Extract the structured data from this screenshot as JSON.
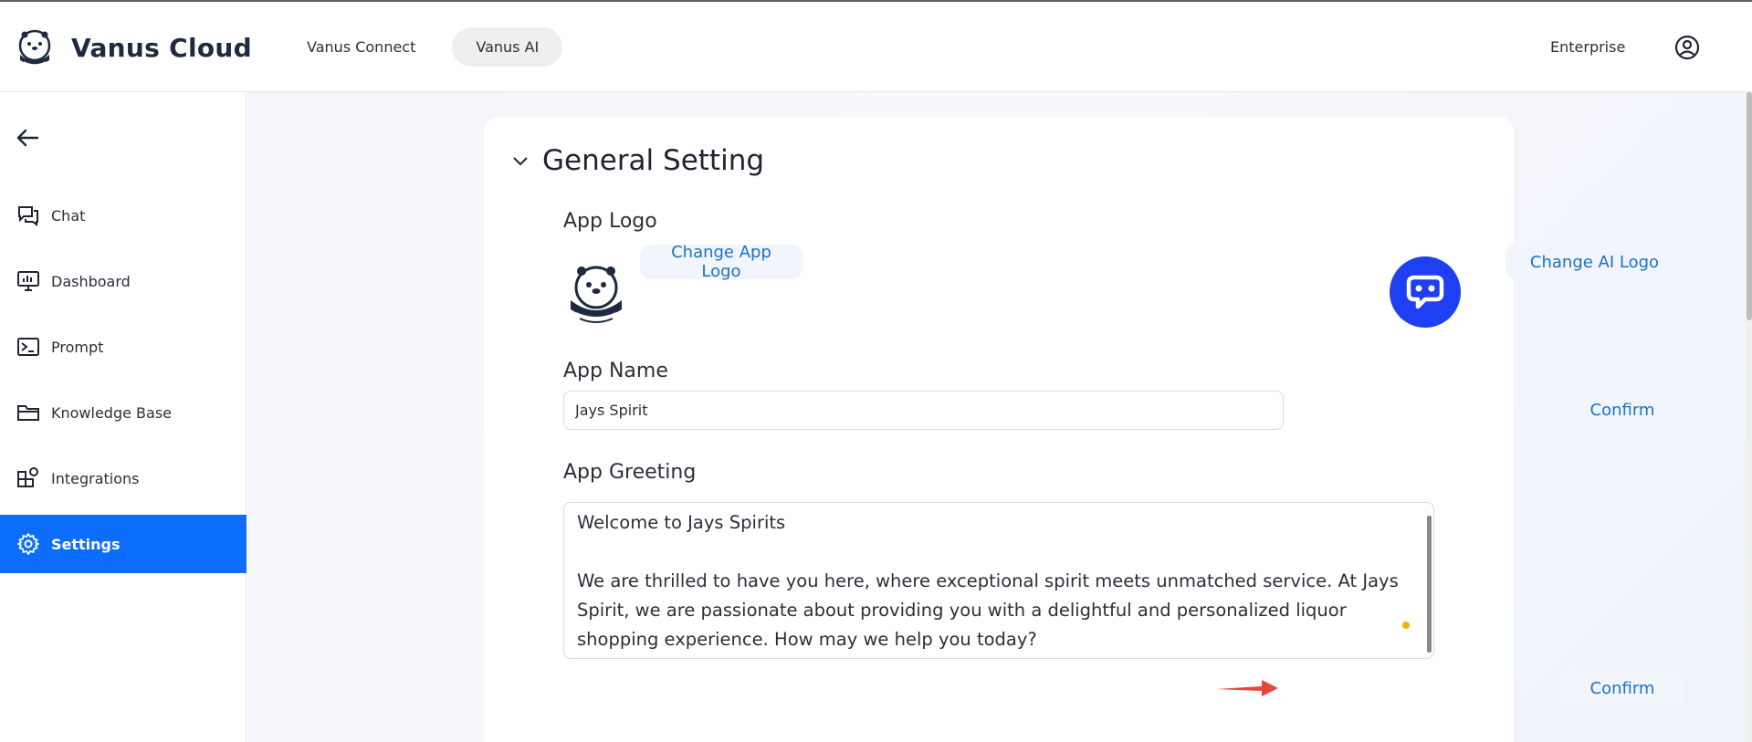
{
  "header": {
    "brand_name": "Vanus Cloud",
    "nav": [
      {
        "label": "Vanus Connect",
        "active": false
      },
      {
        "label": "Vanus AI",
        "active": true
      }
    ],
    "enterprise_label": "Enterprise"
  },
  "sidebar": {
    "items": [
      {
        "label": "Chat",
        "icon": "chat-icon",
        "active": false
      },
      {
        "label": "Dashboard",
        "icon": "dashboard-icon",
        "active": false
      },
      {
        "label": "Prompt",
        "icon": "terminal-icon",
        "active": false
      },
      {
        "label": "Knowledge Base",
        "icon": "folder-icon",
        "active": false
      },
      {
        "label": "Integrations",
        "icon": "integrations-icon",
        "active": false
      },
      {
        "label": "Settings",
        "icon": "gear-icon",
        "active": true
      }
    ]
  },
  "settings": {
    "section_title": "General Setting",
    "app_logo_label": "App Logo",
    "change_app_logo": "Change App Logo",
    "change_ai_logo": "Change AI Logo",
    "app_name_label": "App Name",
    "app_name_value": "Jays Spirit",
    "confirm_label": "Confirm",
    "app_greeting_label": "App Greeting",
    "app_greeting_value": "Welcome to Jays Spirits\n\nWe are thrilled to have you here, where exceptional spirit meets unmatched service. At Jays Spirit, we are passionate about providing you with a delightful and personalized liquor shopping experience. How may we help you today?"
  },
  "colors": {
    "accent": "#0d6efd",
    "link": "#1a73c8",
    "ai_logo": "#1f3ff2",
    "annotation_arrow": "#e8443a"
  }
}
